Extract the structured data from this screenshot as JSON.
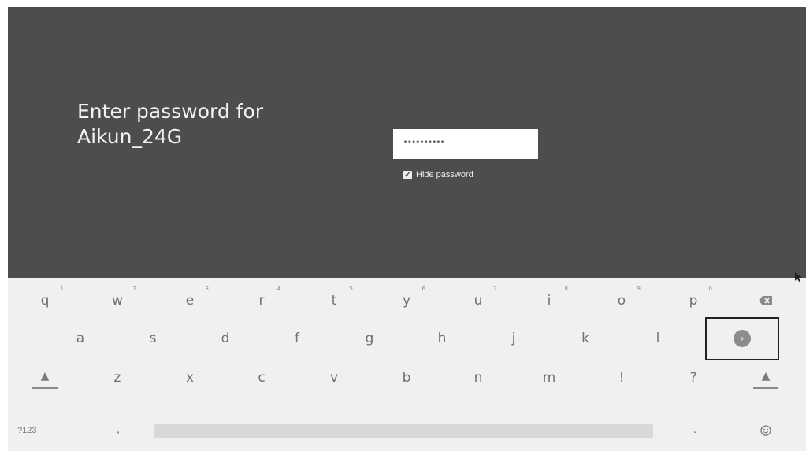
{
  "dialog": {
    "prompt_line1": "Enter password for",
    "prompt_line2": "Aikun_24G",
    "password_value": "••••••••••",
    "hide_password_checked": true,
    "hide_password_label": "Hide password"
  },
  "keyboard": {
    "row1": [
      {
        "label": "q",
        "hint": "1"
      },
      {
        "label": "w",
        "hint": "2"
      },
      {
        "label": "e",
        "hint": "3"
      },
      {
        "label": "r",
        "hint": "4"
      },
      {
        "label": "t",
        "hint": "5"
      },
      {
        "label": "y",
        "hint": "6"
      },
      {
        "label": "u",
        "hint": "7"
      },
      {
        "label": "i",
        "hint": "8"
      },
      {
        "label": "o",
        "hint": "9"
      },
      {
        "label": "p",
        "hint": "0"
      }
    ],
    "row2": [
      "a",
      "s",
      "d",
      "f",
      "g",
      "h",
      "j",
      "k",
      "l"
    ],
    "row3": [
      "z",
      "x",
      "c",
      "v",
      "b",
      "n",
      "m",
      "!",
      "?"
    ],
    "symbols_label": "?123",
    "comma": ",",
    "period": ".",
    "icons": {
      "backspace": "backspace-icon",
      "enter": "go-arrow-icon",
      "shift": "shift-icon",
      "emoji": "emoji-icon"
    }
  },
  "colors": {
    "dialog_bg": "#4d4d4d",
    "keyboard_bg": "#f0f0f0",
    "key_text": "#707070"
  }
}
